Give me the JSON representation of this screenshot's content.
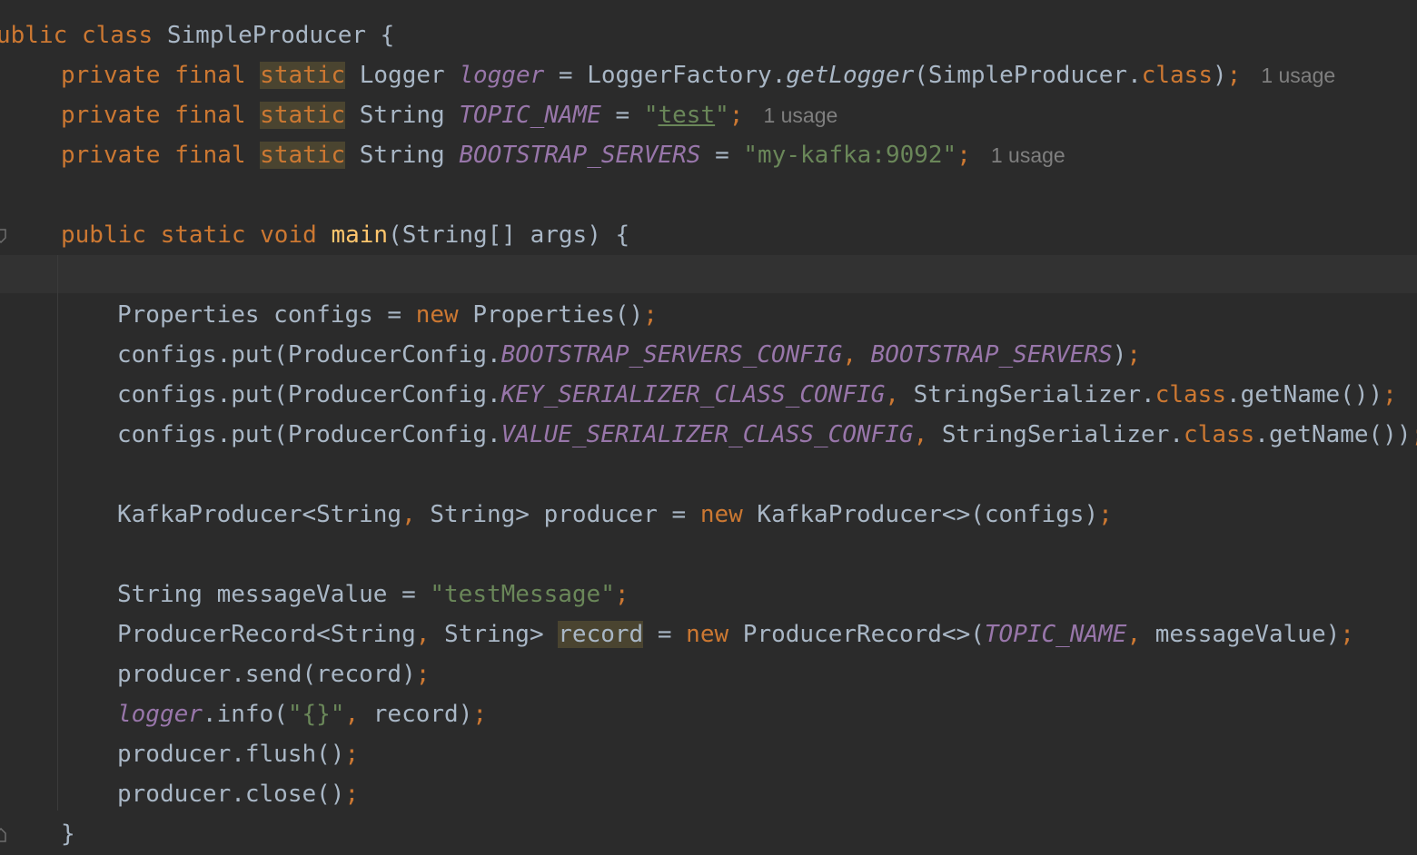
{
  "editor": {
    "language": "Java",
    "class_header": {
      "kw_public_partial": "ublic",
      "kw_class": "class",
      "name": "SimpleProducer",
      "brace": " {"
    },
    "field_logger": {
      "private": "private",
      "final": "final",
      "static": "static",
      "type": "Logger",
      "name": "logger",
      "eq": " = ",
      "factory": "LoggerFactory.",
      "method": "getLogger",
      "arg": "(SimpleProducer.",
      "class_kw": "class",
      "close": ")",
      "semi": ";",
      "usage": "1 usage"
    },
    "field_topic": {
      "private": "private",
      "final": "final",
      "static": "static",
      "type": "String",
      "name": "TOPIC_NAME",
      "eq": " = ",
      "quote_open": "\"",
      "value": "test",
      "quote_close": "\"",
      "semi": ";",
      "usage": "1 usage"
    },
    "field_bootstrap": {
      "private": "private",
      "final": "final",
      "static": "static",
      "type": "String",
      "name": "BOOTSTRAP_SERVERS",
      "eq": " = ",
      "value": "\"my-kafka:9092\"",
      "semi": ";",
      "usage": "1 usage"
    },
    "main_sig": {
      "public": "public",
      "static": "static",
      "void": "void",
      "name": "main",
      "params": "(String[] args) {"
    },
    "line_props": {
      "text": "Properties configs = ",
      "new": "new",
      "rest": " Properties()",
      "semi": ";"
    },
    "line_put1": {
      "pre": "configs.put(ProducerConfig.",
      "const": "BOOTSTRAP_SERVERS_CONFIG",
      "comma": ", ",
      "arg": "BOOTSTRAP_SERVERS",
      "close": ")",
      "semi": ";"
    },
    "line_put2": {
      "pre": "configs.put(ProducerConfig.",
      "const": "KEY_SERIALIZER_CLASS_CONFIG",
      "comma": ", ",
      "arg": "StringSerializer.",
      "class_kw": "class",
      "rest": ".getName())",
      "semi": ";"
    },
    "line_put3": {
      "pre": "configs.put(ProducerConfig.",
      "const": "VALUE_SERIALIZER_CLASS_CONFIG",
      "comma": ", ",
      "arg": "StringSerializer.",
      "class_kw": "class",
      "rest": ".getName())",
      "semi": ";"
    },
    "line_producer": {
      "pre": "KafkaProducer<String",
      "comma": ",",
      "mid": " String> producer = ",
      "new": "new",
      "rest": " KafkaProducer<>(configs)",
      "semi": ";"
    },
    "line_msg": {
      "pre": "String messageValue = ",
      "value": "\"testMessage\"",
      "semi": ";"
    },
    "line_record": {
      "pre": "ProducerRecord<String",
      "comma": ",",
      "mid": " String> ",
      "var": "record",
      "eq": " = ",
      "new": "new",
      "rest": " ProducerRecord<>(",
      "const": "TOPIC_NAME",
      "comma2": ",",
      "rest2": " messageValue)",
      "semi": ";"
    },
    "line_send": {
      "text": "producer.send(record)",
      "semi": ";"
    },
    "line_log": {
      "logger": "logger",
      "pre": ".info(",
      "value": "\"{}\"",
      "comma": ",",
      "rest": " record)",
      "semi": ";"
    },
    "line_flush": {
      "text": "producer.flush()",
      "semi": ";"
    },
    "line_close": {
      "text": "producer.close()",
      "semi": ";"
    },
    "line_end": {
      "text": "}"
    }
  }
}
